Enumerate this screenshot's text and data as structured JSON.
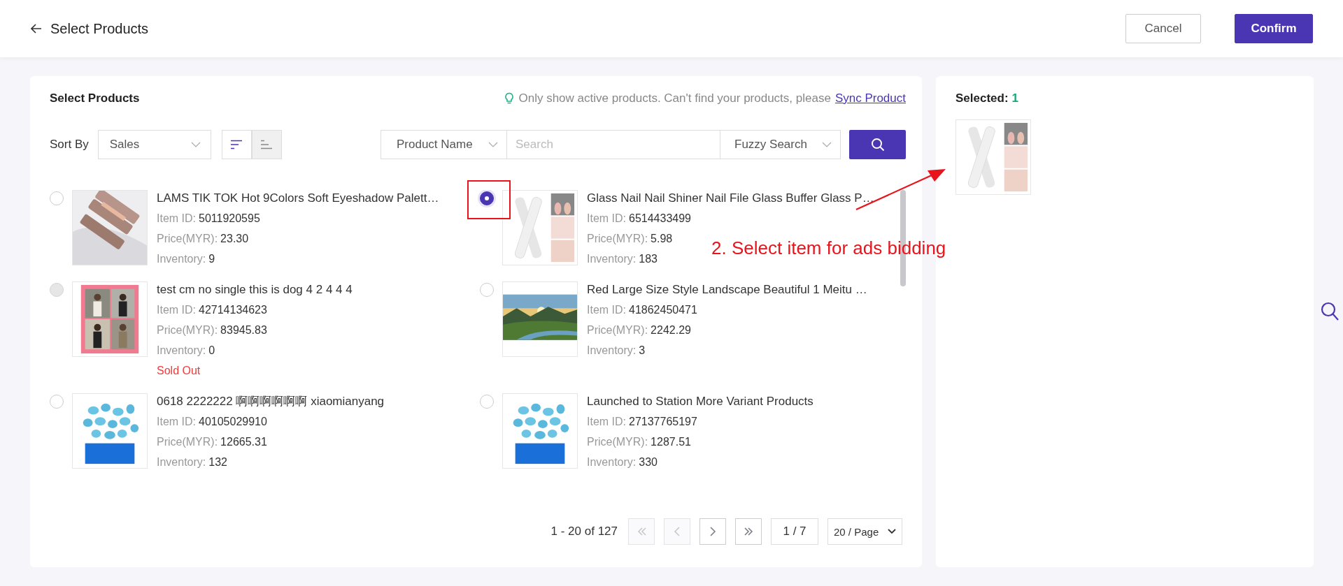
{
  "header": {
    "title": "Select Products",
    "buttons": [
      {
        "label": "Cancel",
        "kind": "secondary"
      },
      {
        "label": "Confirm",
        "kind": "primary"
      }
    ]
  },
  "products_panel": {
    "title": "Select Products",
    "notice": "Only show active products. Can't find your products, please",
    "notice_link": "Sync Product",
    "sort": {
      "label": "Sort By",
      "value": "Sales",
      "orders": [
        {
          "kind": "descending",
          "selected": true
        },
        {
          "kind": "ascending",
          "selected": false
        }
      ]
    },
    "search": {
      "field": "Product Name",
      "placeholder": "Search",
      "mode": "Fuzzy Search"
    },
    "products": [
      {
        "name": "LAMS TIK TOK Hot 9Colors Soft Eyeshadow Palett…",
        "id_label": "Item ID:",
        "item_id": "5011920595",
        "price_label": "Price(MYR):",
        "price": "23.30",
        "inventory_label": "Inventory:",
        "inventory": "9",
        "selected": false,
        "disabled": false
      },
      {
        "name": "Glass Nail Nail Shiner Nail File Glass Buffer Glass P…",
        "id_label": "Item ID:",
        "item_id": "6514433499",
        "price_label": "Price(MYR):",
        "price": "5.98",
        "inventory_label": "Inventory:",
        "inventory": "183",
        "selected": true,
        "disabled": false
      },
      {
        "name": "test cm no single this is dog 4 2 4 4 4",
        "id_label": "Item ID:",
        "item_id": "42714134623",
        "price_label": "Price(MYR):",
        "price": "83945.83",
        "inventory_label": "Inventory:",
        "inventory": "0",
        "status": "Sold Out",
        "selected": false,
        "disabled": true
      },
      {
        "name": "Red Large Size Style Landscape Beautiful 1 Meitu …",
        "id_label": "Item ID:",
        "item_id": "41862450471",
        "price_label": "Price(MYR):",
        "price": "2242.29",
        "inventory_label": "Inventory:",
        "inventory": "3",
        "selected": false,
        "disabled": false
      },
      {
        "name": "0618 2222222 啊啊啊啊啊啊 xiaomianyang",
        "id_label": "Item ID:",
        "item_id": "40105029910",
        "price_label": "Price(MYR):",
        "price": "12665.31",
        "inventory_label": "Inventory:",
        "inventory": "132",
        "selected": false,
        "disabled": false
      },
      {
        "name": "Launched to Station More Variant Products",
        "id_label": "Item ID:",
        "item_id": "27137765197",
        "price_label": "Price(MYR):",
        "price": "1287.51",
        "inventory_label": "Inventory:",
        "inventory": "330",
        "selected": false,
        "disabled": false
      }
    ],
    "pagination": {
      "summary": "1 - 20 of 127",
      "nav": [
        {
          "kind": "first",
          "disabled": true
        },
        {
          "kind": "prev",
          "disabled": true
        },
        {
          "kind": "next",
          "disabled": false
        },
        {
          "kind": "last",
          "disabled": false
        }
      ],
      "page": "1 / 7",
      "page_size": "20 / Page"
    }
  },
  "selected_panel": {
    "label": "Selected:",
    "count": "1"
  },
  "annotation": {
    "text": "2. Select item for ads bidding"
  }
}
